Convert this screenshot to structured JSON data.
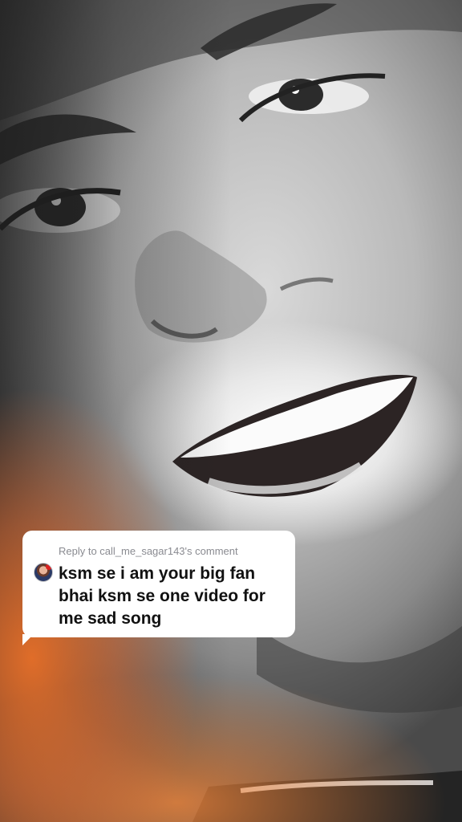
{
  "comment_reply": {
    "header": "Reply to call_me_sagar143's comment",
    "text": "ksm se i am your big fan bhai ksm se one video for me sad song"
  },
  "icons": {
    "avatar": "commenter-avatar-icon"
  },
  "colors": {
    "bubble_background": "#ffffff",
    "header_text": "#8a8b91",
    "comment_text": "#111111",
    "overlay_accent": "#ff7a2e"
  }
}
